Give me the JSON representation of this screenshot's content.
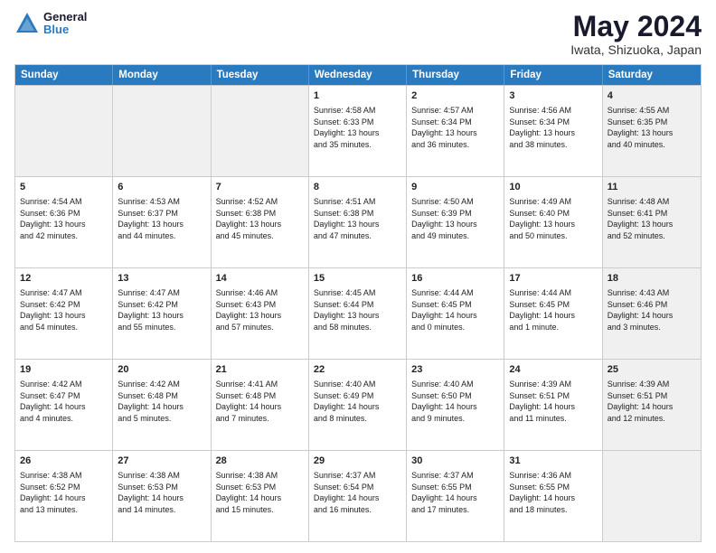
{
  "logo": {
    "line1": "General",
    "line2": "Blue"
  },
  "title": "May 2024",
  "location": "Iwata, Shizuoka, Japan",
  "weekdays": [
    "Sunday",
    "Monday",
    "Tuesday",
    "Wednesday",
    "Thursday",
    "Friday",
    "Saturday"
  ],
  "weeks": [
    [
      {
        "day": "",
        "text": "",
        "shaded": true
      },
      {
        "day": "",
        "text": "",
        "shaded": true
      },
      {
        "day": "",
        "text": "",
        "shaded": true
      },
      {
        "day": "1",
        "text": "Sunrise: 4:58 AM\nSunset: 6:33 PM\nDaylight: 13 hours\nand 35 minutes."
      },
      {
        "day": "2",
        "text": "Sunrise: 4:57 AM\nSunset: 6:34 PM\nDaylight: 13 hours\nand 36 minutes."
      },
      {
        "day": "3",
        "text": "Sunrise: 4:56 AM\nSunset: 6:34 PM\nDaylight: 13 hours\nand 38 minutes."
      },
      {
        "day": "4",
        "text": "Sunrise: 4:55 AM\nSunset: 6:35 PM\nDaylight: 13 hours\nand 40 minutes.",
        "shaded": true
      }
    ],
    [
      {
        "day": "5",
        "text": "Sunrise: 4:54 AM\nSunset: 6:36 PM\nDaylight: 13 hours\nand 42 minutes."
      },
      {
        "day": "6",
        "text": "Sunrise: 4:53 AM\nSunset: 6:37 PM\nDaylight: 13 hours\nand 44 minutes."
      },
      {
        "day": "7",
        "text": "Sunrise: 4:52 AM\nSunset: 6:38 PM\nDaylight: 13 hours\nand 45 minutes."
      },
      {
        "day": "8",
        "text": "Sunrise: 4:51 AM\nSunset: 6:38 PM\nDaylight: 13 hours\nand 47 minutes."
      },
      {
        "day": "9",
        "text": "Sunrise: 4:50 AM\nSunset: 6:39 PM\nDaylight: 13 hours\nand 49 minutes."
      },
      {
        "day": "10",
        "text": "Sunrise: 4:49 AM\nSunset: 6:40 PM\nDaylight: 13 hours\nand 50 minutes."
      },
      {
        "day": "11",
        "text": "Sunrise: 4:48 AM\nSunset: 6:41 PM\nDaylight: 13 hours\nand 52 minutes.",
        "shaded": true
      }
    ],
    [
      {
        "day": "12",
        "text": "Sunrise: 4:47 AM\nSunset: 6:42 PM\nDaylight: 13 hours\nand 54 minutes."
      },
      {
        "day": "13",
        "text": "Sunrise: 4:47 AM\nSunset: 6:42 PM\nDaylight: 13 hours\nand 55 minutes."
      },
      {
        "day": "14",
        "text": "Sunrise: 4:46 AM\nSunset: 6:43 PM\nDaylight: 13 hours\nand 57 minutes."
      },
      {
        "day": "15",
        "text": "Sunrise: 4:45 AM\nSunset: 6:44 PM\nDaylight: 13 hours\nand 58 minutes."
      },
      {
        "day": "16",
        "text": "Sunrise: 4:44 AM\nSunset: 6:45 PM\nDaylight: 14 hours\nand 0 minutes."
      },
      {
        "day": "17",
        "text": "Sunrise: 4:44 AM\nSunset: 6:45 PM\nDaylight: 14 hours\nand 1 minute."
      },
      {
        "day": "18",
        "text": "Sunrise: 4:43 AM\nSunset: 6:46 PM\nDaylight: 14 hours\nand 3 minutes.",
        "shaded": true
      }
    ],
    [
      {
        "day": "19",
        "text": "Sunrise: 4:42 AM\nSunset: 6:47 PM\nDaylight: 14 hours\nand 4 minutes."
      },
      {
        "day": "20",
        "text": "Sunrise: 4:42 AM\nSunset: 6:48 PM\nDaylight: 14 hours\nand 5 minutes."
      },
      {
        "day": "21",
        "text": "Sunrise: 4:41 AM\nSunset: 6:48 PM\nDaylight: 14 hours\nand 7 minutes."
      },
      {
        "day": "22",
        "text": "Sunrise: 4:40 AM\nSunset: 6:49 PM\nDaylight: 14 hours\nand 8 minutes."
      },
      {
        "day": "23",
        "text": "Sunrise: 4:40 AM\nSunset: 6:50 PM\nDaylight: 14 hours\nand 9 minutes."
      },
      {
        "day": "24",
        "text": "Sunrise: 4:39 AM\nSunset: 6:51 PM\nDaylight: 14 hours\nand 11 minutes."
      },
      {
        "day": "25",
        "text": "Sunrise: 4:39 AM\nSunset: 6:51 PM\nDaylight: 14 hours\nand 12 minutes.",
        "shaded": true
      }
    ],
    [
      {
        "day": "26",
        "text": "Sunrise: 4:38 AM\nSunset: 6:52 PM\nDaylight: 14 hours\nand 13 minutes."
      },
      {
        "day": "27",
        "text": "Sunrise: 4:38 AM\nSunset: 6:53 PM\nDaylight: 14 hours\nand 14 minutes."
      },
      {
        "day": "28",
        "text": "Sunrise: 4:38 AM\nSunset: 6:53 PM\nDaylight: 14 hours\nand 15 minutes."
      },
      {
        "day": "29",
        "text": "Sunrise: 4:37 AM\nSunset: 6:54 PM\nDaylight: 14 hours\nand 16 minutes."
      },
      {
        "day": "30",
        "text": "Sunrise: 4:37 AM\nSunset: 6:55 PM\nDaylight: 14 hours\nand 17 minutes."
      },
      {
        "day": "31",
        "text": "Sunrise: 4:36 AM\nSunset: 6:55 PM\nDaylight: 14 hours\nand 18 minutes."
      },
      {
        "day": "",
        "text": "",
        "shaded": true
      }
    ]
  ]
}
